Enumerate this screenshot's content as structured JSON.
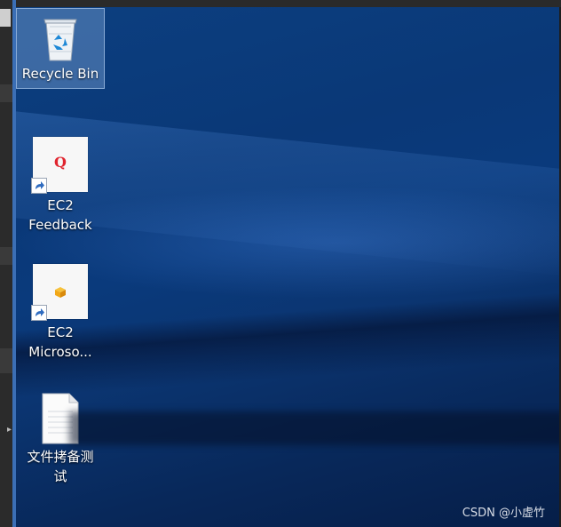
{
  "desktop": {
    "icons": [
      {
        "label": "Recycle Bin",
        "icon": "recycle-bin-icon",
        "selected": true
      },
      {
        "label_line1": "EC2",
        "label_line2": "Feedback",
        "icon": "ec2-feedback-icon",
        "glyph": "Q",
        "glyph_color": "#e0242e"
      },
      {
        "label_line1": "EC2",
        "label_line2": "Microso...",
        "icon": "ec2-microsoft-icon",
        "glyph_color": "#f2a818"
      },
      {
        "label_line1": "文件拷备测",
        "label_line2": "试",
        "icon": "text-document-icon"
      }
    ]
  },
  "watermark": "CSDN @小虚竹",
  "colors": {
    "wallpaper": "#0a3877",
    "selection": "#7aa0d2"
  }
}
